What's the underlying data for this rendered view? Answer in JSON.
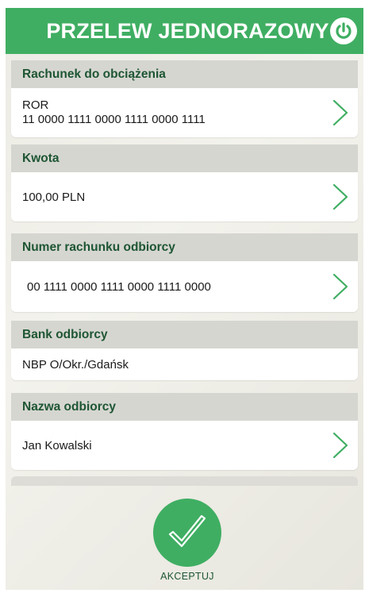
{
  "header": {
    "title": "PRZELEW JEDNORAZOWY",
    "power_icon": "power-icon"
  },
  "colors": {
    "brand_green": "#3fae62",
    "label_green": "#1e5633",
    "section_gray": "#d6d6d1"
  },
  "sections": [
    {
      "label": "Rachunek do obciążenia",
      "line1": "ROR",
      "line2": "11 0000 1111 0000 1111 0000 1111"
    },
    {
      "label": "Kwota",
      "value": "100,00 PLN"
    },
    {
      "label": "Numer rachunku odbiorcy",
      "value": "00 1111 0000 1111 0000 1111 0000"
    },
    {
      "label": "Bank odbiorcy",
      "value": "NBP O/Okr./Gdańsk"
    },
    {
      "label": "Nazwa odbiorcy",
      "value": "Jan Kowalski"
    }
  ],
  "footer": {
    "accept_label": "AKCEPTUJ"
  }
}
